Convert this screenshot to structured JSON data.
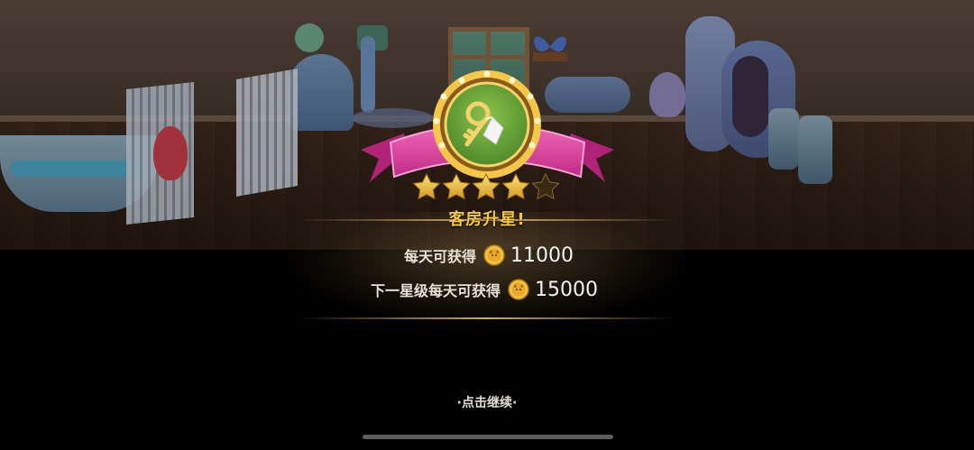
{
  "title": "客房升星!",
  "stars": {
    "filled": 4,
    "total": 5
  },
  "badge_icon": "key-with-tag-icon",
  "income": {
    "label": "每天可获得",
    "value": "11000"
  },
  "next_income": {
    "label": "下一星级每天可获得",
    "value": "15000"
  },
  "coin_icon": "cat-coin-icon",
  "continue_text": "·点击继续·",
  "colors": {
    "title": "#f5c842",
    "ribbon": "#e23a9a",
    "badge_green": "#6fa53a",
    "gold": "#e3b23c"
  }
}
